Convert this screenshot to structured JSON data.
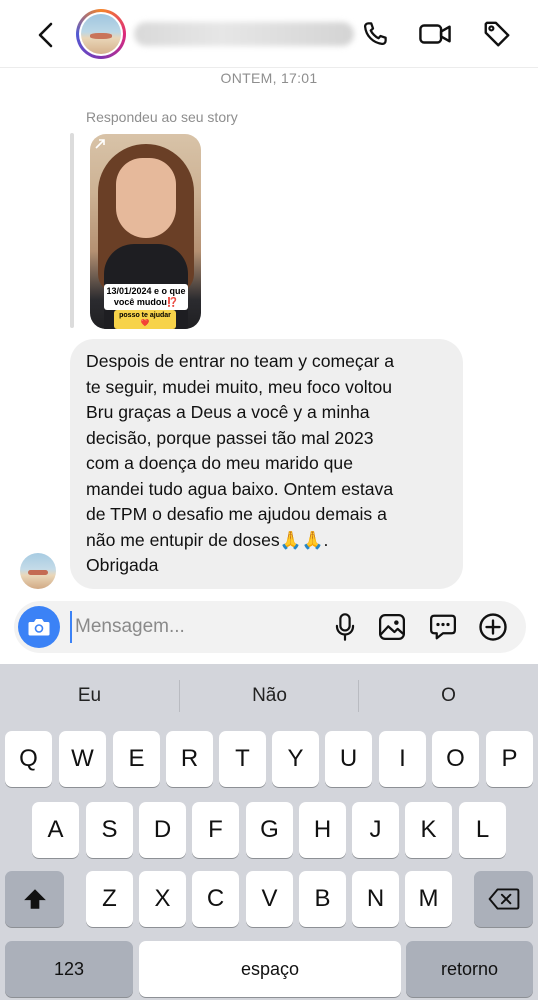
{
  "header": {
    "back_icon": "chevron-left-icon",
    "call_icon": "phone-icon",
    "video_icon": "video-camera-icon",
    "tag_icon": "tag-icon"
  },
  "conversation": {
    "timestamp": "ONTEM, 17:01",
    "story_reply_label": "Respondeu ao seu story",
    "story": {
      "caption": "13/01/2024 e o que você mudou⁉️",
      "sticker": "posso te ajudar❤️"
    },
    "message": "Despois de entrar no team y começar a\nte seguir, mudei muito, meu foco voltou\nBru graças a Deus a você y a minha\ndecisão, porque passei tão mal 2023\ncom a doença do meu marido que\nmandei tudo agua baixo. Ontem estava\nde TPM o desafio me ajudou demais a\nnão me entupir de doses🙏🙏.\nObrigada"
  },
  "composer": {
    "placeholder": "Mensagem...",
    "value": "",
    "accent": "#3b82f6"
  },
  "keyboard": {
    "suggestions": [
      "Eu",
      "Não",
      "O"
    ],
    "row1": [
      "Q",
      "W",
      "E",
      "R",
      "T",
      "Y",
      "U",
      "I",
      "O",
      "P"
    ],
    "row2": [
      "A",
      "S",
      "D",
      "F",
      "G",
      "H",
      "J",
      "K",
      "L"
    ],
    "row3": [
      "Z",
      "X",
      "C",
      "V",
      "B",
      "N",
      "M"
    ],
    "numbers_key": "123",
    "space_key": "espaço",
    "return_key": "retorno"
  }
}
